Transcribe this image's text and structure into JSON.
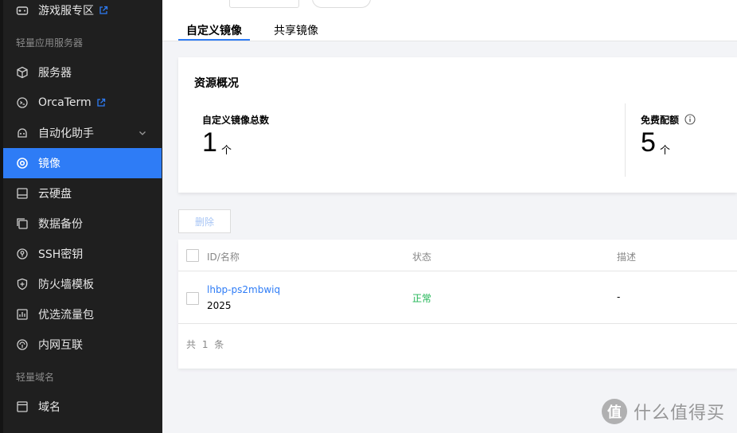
{
  "sidebar": {
    "items": [
      {
        "label": "游戏服专区",
        "icon": "gamepad-icon",
        "external": true
      },
      {
        "label": "服务器",
        "icon": "cube-icon"
      },
      {
        "label": "OrcaTerm",
        "icon": "terminal-icon",
        "external": true
      },
      {
        "label": "自动化助手",
        "icon": "automation-icon",
        "expandable": true
      },
      {
        "label": "镜像",
        "icon": "image-disc-icon",
        "active": true
      },
      {
        "label": "云硬盘",
        "icon": "disk-icon"
      },
      {
        "label": "数据备份",
        "icon": "backup-icon"
      },
      {
        "label": "SSH密钥",
        "icon": "key-icon"
      },
      {
        "label": "防火墙模板",
        "icon": "shield-icon"
      },
      {
        "label": "优选流量包",
        "icon": "traffic-icon"
      },
      {
        "label": "内网互联",
        "icon": "network-icon"
      },
      {
        "label": "域名",
        "icon": "domain-icon"
      }
    ],
    "groups": {
      "lighthouse": "轻量应用服务器",
      "domain": "轻量域名"
    }
  },
  "tabs": [
    {
      "label": "自定义镜像",
      "active": true
    },
    {
      "label": "共享镜像",
      "active": false
    }
  ],
  "overview": {
    "title": "资源概况",
    "custom_total_label": "自定义镜像总数",
    "custom_total_value": "1",
    "custom_total_unit": "个",
    "free_quota_label": "免费配额",
    "free_quota_value": "5",
    "free_quota_unit": "个"
  },
  "toolbar": {
    "delete_label": "删除"
  },
  "table": {
    "columns": [
      "ID/名称",
      "状态",
      "描述"
    ],
    "rows": [
      {
        "id": "lhbp-ps2mbwiq",
        "name": "2025",
        "status": "正常",
        "description": "-"
      }
    ],
    "footer": "共 1 条"
  },
  "colors": {
    "accent": "#2e7cf6",
    "sidebar_bg": "#1f1f1f",
    "status_ok": "#1fb554"
  },
  "watermark": {
    "badge": "值",
    "text": "什么值得买"
  }
}
